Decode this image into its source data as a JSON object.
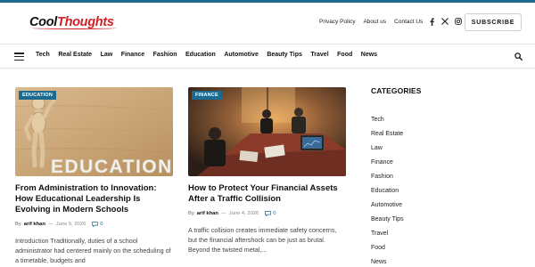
{
  "brand": {
    "logo_part1": "Cool",
    "logo_part2": "Thoughts"
  },
  "top_links": [
    "Privacy Policy",
    "About us",
    "Contact Us"
  ],
  "social": [
    "facebook-icon",
    "x-twitter-icon",
    "instagram-icon"
  ],
  "subscribe_label": "SUBSCRIBE",
  "nav": [
    "Tech",
    "Real Estate",
    "Law",
    "Finance",
    "Fashion",
    "Education",
    "Automotive",
    "Beauty Tips",
    "Travel",
    "Food",
    "News"
  ],
  "posts": [
    {
      "category": "EDUCATION",
      "title": "From Administration to Innovation: How Educational Leadership Is Evolving in Modern Schools",
      "by": "By",
      "author": "arif khan",
      "date": "June 5, 2026",
      "comments": "0",
      "excerpt": "Introduction Traditionally, duties of a school administrator had centered mainly on the scheduling of a timetable, budgets and",
      "image_text": "EDUCATION"
    },
    {
      "category": "FINANCE",
      "title": "How to Protect Your Financial Assets After a Traffic Collision",
      "by": "By",
      "author": "arif khan",
      "date": "June 4, 2026",
      "comments": "0",
      "excerpt": "A traffic collision creates immediate safety concerns, but the financial aftershock can be just as brutal. Beyond the twisted metal,..."
    }
  ],
  "sidebar": {
    "heading": "CATEGORIES",
    "categories": [
      "Tech",
      "Real Estate",
      "Law",
      "Finance",
      "Fashion",
      "Education",
      "Automotive",
      "Beauty Tips",
      "Travel",
      "Food",
      "News"
    ]
  },
  "colors": {
    "accent": "#1a6b8f",
    "brand_red": "#d11f25"
  }
}
